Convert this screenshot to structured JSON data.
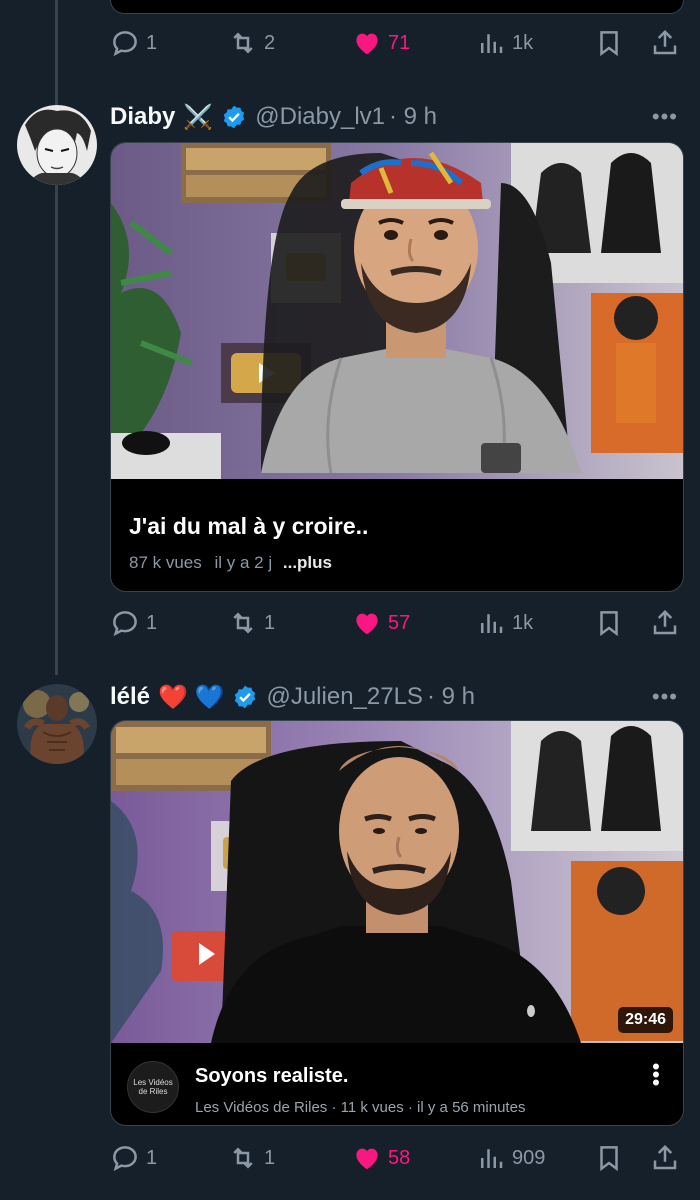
{
  "prev_tweet": {
    "actions": {
      "replies": "1",
      "retweets": "2",
      "likes": "71",
      "views": "1k"
    }
  },
  "tweet1": {
    "name": "Diaby",
    "emoji": "⚔️",
    "handle": "@Diaby_lv1",
    "time": "· 9 h",
    "more": "•••",
    "card": {
      "title": "J'ai du mal à y croire..",
      "views": "87 k vues",
      "age": "il y a 2 j",
      "more_link": "...plus"
    },
    "actions": {
      "replies": "1",
      "retweets": "1",
      "likes": "57",
      "views": "1k"
    }
  },
  "tweet2": {
    "name": "lélé",
    "emoji": "❤️ 💙",
    "handle": "@Julien_27LS",
    "time": "· 9 h",
    "more": "•••",
    "card": {
      "duration": "29:46",
      "channel_avatar_text": "Les Vidéos de Riles",
      "title": "Soyons realiste.",
      "meta": "Les Vidéos de Riles · 11 k vues · il y a 56 minutes"
    },
    "actions": {
      "replies": "1",
      "retweets": "1",
      "likes": "58",
      "views": "909"
    }
  },
  "colors": {
    "background": "#15202b",
    "like_pink": "#f91880",
    "verified_blue": "#1d9bf0",
    "muted": "#8b98a5"
  },
  "icons": [
    "reply-icon",
    "retweet-icon",
    "heart-icon",
    "views-icon",
    "bookmark-icon",
    "share-icon",
    "verified-badge-icon"
  ]
}
